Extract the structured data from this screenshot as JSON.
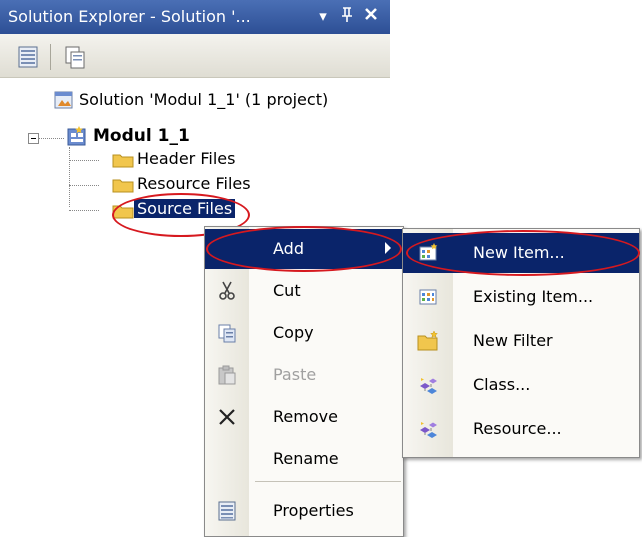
{
  "window": {
    "title": "Solution Explorer - Solution '...",
    "pin_glyph": "−⌂",
    "dropdown_glyph": "▾",
    "pin_label": "ᵀ",
    "close_glyph": "✕"
  },
  "toolbar": {
    "buttons": [
      {
        "name": "properties-icon"
      },
      {
        "name": "show-all-files-icon"
      }
    ]
  },
  "tree": {
    "solution_label": "Solution 'Modul 1_1' (1 project)",
    "project_label": "Modul 1_1",
    "folders": [
      {
        "label": "Header Files"
      },
      {
        "label": "Resource Files"
      },
      {
        "label": "Source Files",
        "selected": true
      }
    ]
  },
  "context_menu": {
    "items": [
      {
        "label": "Add",
        "icon": "",
        "state": "highlighted",
        "submenu": true
      },
      {
        "label": "Cut",
        "icon": "scissors-icon"
      },
      {
        "label": "Copy",
        "icon": "copy-icon"
      },
      {
        "label": "Paste",
        "icon": "paste-icon",
        "state": "disabled"
      },
      {
        "label": "Remove",
        "icon": "remove-icon"
      },
      {
        "label": "Rename",
        "icon": ""
      },
      {
        "label": "Properties",
        "icon": "properties-icon"
      }
    ]
  },
  "submenu": {
    "items": [
      {
        "label": "New Item...",
        "icon": "new-item-icon",
        "state": "highlighted"
      },
      {
        "label": "Existing Item...",
        "icon": "existing-item-icon"
      },
      {
        "label": "New Filter",
        "icon": "new-filter-icon"
      },
      {
        "label": "Class...",
        "icon": "class-icon"
      },
      {
        "label": "Resource...",
        "icon": "resource-icon"
      }
    ]
  },
  "colors": {
    "title_bar": "#2d4f95",
    "selection": "#0a246a",
    "annotation_ellipse": "#d6191f"
  }
}
